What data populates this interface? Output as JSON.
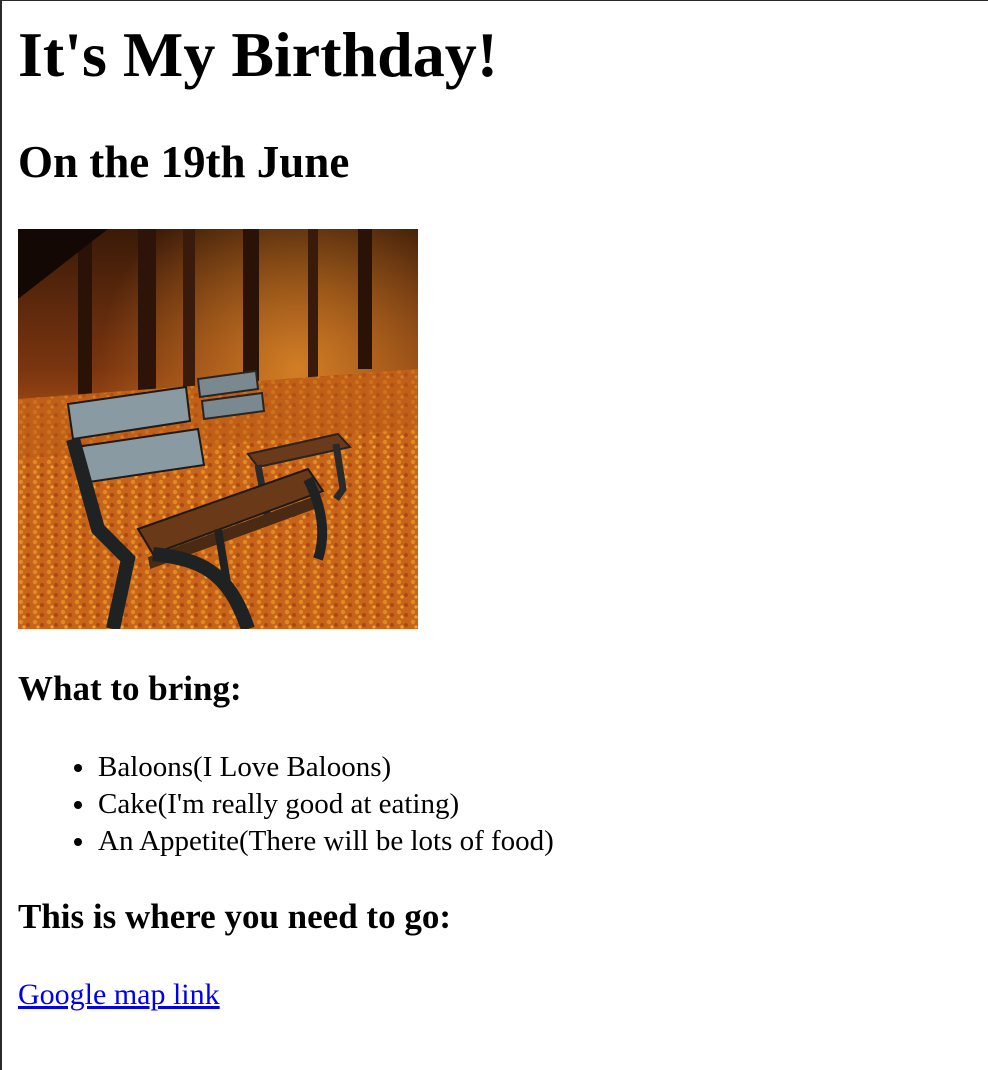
{
  "page": {
    "title": "It's My Birthday!",
    "date": "On the 19th June",
    "photo_alt": "",
    "bring_heading": "What to bring:",
    "bring_items": [
      "Baloons(I Love Baloons)",
      "Cake(I'm really good at eating)",
      "An Appetite(There will be lots of food)"
    ],
    "where_heading": "This is where you need to go:",
    "map_link_text": "Google map link"
  },
  "colors": {
    "link": "#0000ee",
    "text": "#000000",
    "background": "#ffffff"
  }
}
